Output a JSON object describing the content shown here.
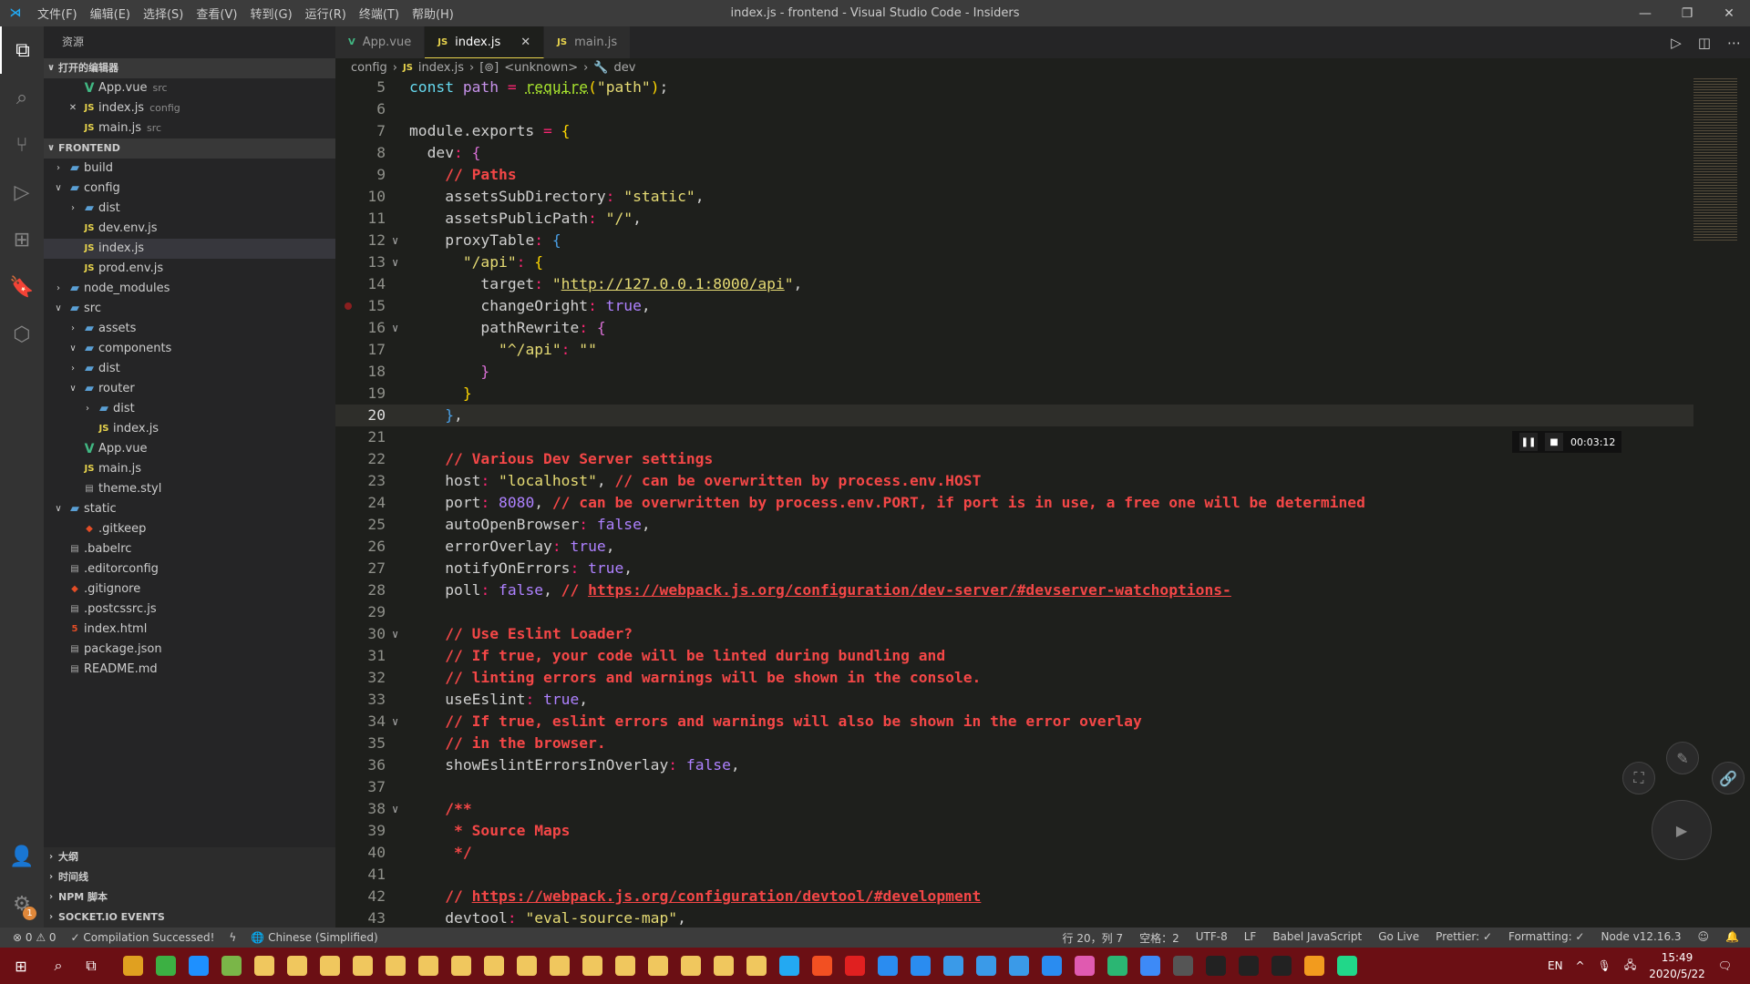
{
  "titlebar": {
    "menus": [
      "文件(F)",
      "编辑(E)",
      "选择(S)",
      "查看(V)",
      "转到(G)",
      "运行(R)",
      "终端(T)",
      "帮助(H)"
    ],
    "title": "index.js - frontend - Visual Studio Code - Insiders"
  },
  "activity": [
    "explorer-icon",
    "search-icon",
    "source-control-icon",
    "run-debug-icon",
    "extensions-icon",
    "bookmark-icon",
    "package-icon"
  ],
  "activity_bottom": {
    "account": "account-icon",
    "settings": "gear-icon",
    "badge": "1"
  },
  "sidebar": {
    "header": "资源",
    "rows": [
      {
        "type": "section",
        "label": "打开的编辑器",
        "open": true
      },
      {
        "depth": 1,
        "icon": "vue",
        "label": "App.vue",
        "desc": "src"
      },
      {
        "depth": 1,
        "icon": "js",
        "label": "index.js",
        "desc": "config",
        "close": true
      },
      {
        "depth": 1,
        "icon": "js",
        "label": "main.js",
        "desc": "src"
      },
      {
        "type": "section",
        "label": "FRONTEND",
        "open": true
      },
      {
        "depth": 0,
        "icon": "folder",
        "label": "build",
        "chev": "closed"
      },
      {
        "depth": 0,
        "icon": "folder",
        "label": "config",
        "chev": "open"
      },
      {
        "depth": 1,
        "icon": "folder",
        "label": "dist",
        "chev": "closed"
      },
      {
        "depth": 1,
        "icon": "js",
        "label": "dev.env.js"
      },
      {
        "depth": 1,
        "icon": "js",
        "label": "index.js",
        "selected": true
      },
      {
        "depth": 1,
        "icon": "js",
        "label": "prod.env.js"
      },
      {
        "depth": 0,
        "icon": "folder",
        "label": "node_modules",
        "chev": "closed"
      },
      {
        "depth": 0,
        "icon": "folder",
        "label": "src",
        "chev": "open"
      },
      {
        "depth": 1,
        "icon": "folder",
        "label": "assets",
        "chev": "closed"
      },
      {
        "depth": 1,
        "icon": "folder",
        "label": "components",
        "chev": "open"
      },
      {
        "depth": 1,
        "icon": "folder",
        "label": "dist",
        "chev": "closed"
      },
      {
        "depth": 1,
        "icon": "folder",
        "label": "router",
        "chev": "open"
      },
      {
        "depth": 2,
        "icon": "folder",
        "label": "dist",
        "chev": "closed"
      },
      {
        "depth": 2,
        "icon": "js",
        "label": "index.js"
      },
      {
        "depth": 1,
        "icon": "vue",
        "label": "App.vue"
      },
      {
        "depth": 1,
        "icon": "js",
        "label": "main.js"
      },
      {
        "depth": 1,
        "icon": "file",
        "label": "theme.styl"
      },
      {
        "depth": 0,
        "icon": "folder",
        "label": "static",
        "chev": "open"
      },
      {
        "depth": 1,
        "icon": "git",
        "label": ".gitkeep"
      },
      {
        "depth": 0,
        "icon": "file",
        "label": ".babelrc"
      },
      {
        "depth": 0,
        "icon": "file",
        "label": ".editorconfig"
      },
      {
        "depth": 0,
        "icon": "git",
        "label": ".gitignore"
      },
      {
        "depth": 0,
        "icon": "file",
        "label": ".postcssrc.js"
      },
      {
        "depth": 0,
        "icon": "html",
        "label": "index.html"
      },
      {
        "depth": 0,
        "icon": "file",
        "label": "package.json"
      },
      {
        "depth": 0,
        "icon": "file",
        "label": "README.md"
      }
    ],
    "bottom": [
      "大纲",
      "时间线",
      "NPM 脚本",
      "SOCKET.IO EVENTS"
    ]
  },
  "tabs": [
    {
      "label": "App.vue",
      "icon": "vue"
    },
    {
      "label": "index.js",
      "icon": "js",
      "active": true
    },
    {
      "label": "main.js",
      "icon": "js"
    }
  ],
  "breadcrumb": [
    "config",
    "index.js",
    "<unknown>",
    "dev"
  ],
  "editor": {
    "current_line": 20,
    "breakpoint_line": 15,
    "fold_lines": [
      12,
      13,
      16,
      30,
      34,
      38
    ],
    "lines": [
      [
        5,
        [
          [
            "kw",
            "const "
          ],
          [
            "v",
            "path"
          ],
          [
            "p",
            " = "
          ],
          [
            "f",
            "require"
          ],
          [
            "b1",
            "("
          ],
          [
            "s",
            "\"path\""
          ],
          [
            "b1",
            ")"
          ],
          [
            "w",
            ";"
          ]
        ]
      ],
      [
        6,
        []
      ],
      [
        7,
        [
          [
            "k",
            "module.exports"
          ],
          [
            "p",
            " = "
          ],
          [
            "b1",
            "{"
          ]
        ]
      ],
      [
        8,
        [
          [
            "w",
            "  "
          ],
          [
            "k",
            "dev"
          ],
          [
            "p",
            ": "
          ],
          [
            "b2",
            "{"
          ]
        ]
      ],
      [
        9,
        [
          [
            "w",
            "    "
          ],
          [
            "c",
            "// Paths"
          ]
        ]
      ],
      [
        10,
        [
          [
            "w",
            "    "
          ],
          [
            "k",
            "assetsSubDirectory"
          ],
          [
            "p",
            ": "
          ],
          [
            "s",
            "\"static\""
          ],
          [
            "w",
            ","
          ]
        ]
      ],
      [
        11,
        [
          [
            "w",
            "    "
          ],
          [
            "k",
            "assetsPublicPath"
          ],
          [
            "p",
            ": "
          ],
          [
            "s",
            "\"/\""
          ],
          [
            "w",
            ","
          ]
        ]
      ],
      [
        12,
        [
          [
            "w",
            "    "
          ],
          [
            "k",
            "proxyTable"
          ],
          [
            "p",
            ": "
          ],
          [
            "b3",
            "{"
          ]
        ]
      ],
      [
        13,
        [
          [
            "w",
            "      "
          ],
          [
            "s",
            "\"/api\""
          ],
          [
            "p",
            ": "
          ],
          [
            "b1",
            "{"
          ]
        ]
      ],
      [
        14,
        [
          [
            "w",
            "        "
          ],
          [
            "k",
            "target"
          ],
          [
            "p",
            ": "
          ],
          [
            "s",
            "\""
          ],
          [
            "su",
            "http://127.0.0.1:8000/api"
          ],
          [
            "s",
            "\""
          ],
          [
            "w",
            ","
          ]
        ]
      ],
      [
        15,
        [
          [
            "w",
            "        "
          ],
          [
            "k",
            "changeOright"
          ],
          [
            "p",
            ": "
          ],
          [
            "b",
            "true"
          ],
          [
            "w",
            ","
          ]
        ]
      ],
      [
        16,
        [
          [
            "w",
            "        "
          ],
          [
            "k",
            "pathRewrite"
          ],
          [
            "p",
            ": "
          ],
          [
            "b2",
            "{"
          ]
        ]
      ],
      [
        17,
        [
          [
            "w",
            "          "
          ],
          [
            "s",
            "\"^/api\""
          ],
          [
            "p",
            ": "
          ],
          [
            "s",
            "\"\""
          ]
        ]
      ],
      [
        18,
        [
          [
            "w",
            "        "
          ],
          [
            "b2",
            "}"
          ]
        ]
      ],
      [
        19,
        [
          [
            "w",
            "      "
          ],
          [
            "b1",
            "}"
          ]
        ]
      ],
      [
        20,
        [
          [
            "w",
            "    "
          ],
          [
            "b3",
            "}"
          ],
          [
            "w",
            ","
          ]
        ]
      ],
      [
        21,
        []
      ],
      [
        22,
        [
          [
            "w",
            "    "
          ],
          [
            "c",
            "// Various Dev Server settings"
          ]
        ]
      ],
      [
        23,
        [
          [
            "w",
            "    "
          ],
          [
            "k",
            "host"
          ],
          [
            "p",
            ": "
          ],
          [
            "s",
            "\"localhost\""
          ],
          [
            "w",
            ", "
          ],
          [
            "c",
            "// can be overwritten by process.env.HOST"
          ]
        ]
      ],
      [
        24,
        [
          [
            "w",
            "    "
          ],
          [
            "k",
            "port"
          ],
          [
            "p",
            ": "
          ],
          [
            "n",
            "8080"
          ],
          [
            "w",
            ", "
          ],
          [
            "c",
            "// can be overwritten by process.env.PORT, if port is in use, a free one will be determined"
          ]
        ]
      ],
      [
        25,
        [
          [
            "w",
            "    "
          ],
          [
            "k",
            "autoOpenBrowser"
          ],
          [
            "p",
            ": "
          ],
          [
            "b",
            "false"
          ],
          [
            "w",
            ","
          ]
        ]
      ],
      [
        26,
        [
          [
            "w",
            "    "
          ],
          [
            "k",
            "errorOverlay"
          ],
          [
            "p",
            ": "
          ],
          [
            "b",
            "true"
          ],
          [
            "w",
            ","
          ]
        ]
      ],
      [
        27,
        [
          [
            "w",
            "    "
          ],
          [
            "k",
            "notifyOnErrors"
          ],
          [
            "p",
            ": "
          ],
          [
            "b",
            "true"
          ],
          [
            "w",
            ","
          ]
        ]
      ],
      [
        28,
        [
          [
            "w",
            "    "
          ],
          [
            "k",
            "poll"
          ],
          [
            "p",
            ": "
          ],
          [
            "b",
            "false"
          ],
          [
            "w",
            ", "
          ],
          [
            "c",
            "// "
          ],
          [
            "cu",
            "https://webpack.js.org/configuration/dev-server/#devserver-watchoptions-"
          ]
        ]
      ],
      [
        29,
        []
      ],
      [
        30,
        [
          [
            "w",
            "    "
          ],
          [
            "c",
            "// Use Eslint Loader?"
          ]
        ]
      ],
      [
        31,
        [
          [
            "w",
            "    "
          ],
          [
            "c",
            "// If true, your code will be linted during bundling and"
          ]
        ]
      ],
      [
        32,
        [
          [
            "w",
            "    "
          ],
          [
            "c",
            "// linting errors and warnings will be shown in the console."
          ]
        ]
      ],
      [
        33,
        [
          [
            "w",
            "    "
          ],
          [
            "k",
            "useEslint"
          ],
          [
            "p",
            ": "
          ],
          [
            "b",
            "true"
          ],
          [
            "w",
            ","
          ]
        ]
      ],
      [
        34,
        [
          [
            "w",
            "    "
          ],
          [
            "c",
            "// If true, eslint errors and warnings will also be shown in the error overlay"
          ]
        ]
      ],
      [
        35,
        [
          [
            "w",
            "    "
          ],
          [
            "c",
            "// in the browser."
          ]
        ]
      ],
      [
        36,
        [
          [
            "w",
            "    "
          ],
          [
            "k",
            "showEslintErrorsInOverlay"
          ],
          [
            "p",
            ": "
          ],
          [
            "b",
            "false"
          ],
          [
            "w",
            ","
          ]
        ]
      ],
      [
        37,
        []
      ],
      [
        38,
        [
          [
            "w",
            "    "
          ],
          [
            "c",
            "/**"
          ]
        ]
      ],
      [
        39,
        [
          [
            "w",
            "    "
          ],
          [
            "c",
            " * Source Maps"
          ]
        ]
      ],
      [
        40,
        [
          [
            "w",
            "    "
          ],
          [
            "c",
            " */"
          ]
        ]
      ],
      [
        41,
        []
      ],
      [
        42,
        [
          [
            "w",
            "    "
          ],
          [
            "c",
            "// "
          ],
          [
            "cu",
            "https://webpack.js.org/configuration/devtool/#development"
          ]
        ]
      ],
      [
        43,
        [
          [
            "w",
            "    "
          ],
          [
            "k",
            "devtool"
          ],
          [
            "p",
            ": "
          ],
          [
            "s",
            "\"eval-source-map\""
          ],
          [
            "w",
            ","
          ]
        ]
      ]
    ]
  },
  "recorder": {
    "time": "00:03:12"
  },
  "statusbar": {
    "errors": "0",
    "warnings": "0",
    "compilation": "✓ Compilation Successed!",
    "language_pack": "Chinese (Simplified)",
    "right": [
      "行 20，列 7",
      "空格：2",
      "UTF-8",
      "LF",
      "Babel JavaScript",
      "Go Live",
      "Prettier: ✓",
      "Formatting: ✓",
      "Node v12.16.3"
    ]
  },
  "taskbar": {
    "apps": [
      [
        "chrome",
        "#e0a020"
      ],
      [
        "360-browser",
        "#3cb043"
      ],
      [
        "qq-browser",
        "#1e90ff"
      ],
      [
        "notepad",
        "#7ab648"
      ],
      [
        "folder",
        "#f0c75e"
      ],
      [
        "folder",
        "#f0c75e"
      ],
      [
        "folder",
        "#f0c75e"
      ],
      [
        "folder",
        "#f0c75e"
      ],
      [
        "folder",
        "#f0c75e"
      ],
      [
        "folder",
        "#f0c75e"
      ],
      [
        "folder",
        "#f0c75e"
      ],
      [
        "folder",
        "#f0c75e"
      ],
      [
        "folder",
        "#f0c75e"
      ],
      [
        "folder",
        "#f0c75e"
      ],
      [
        "folder",
        "#f0c75e"
      ],
      [
        "folder",
        "#f0c75e"
      ],
      [
        "folder",
        "#f0c75e"
      ],
      [
        "folder",
        "#f0c75e"
      ],
      [
        "folder",
        "#f0c75e"
      ],
      [
        "folder",
        "#f0c75e"
      ],
      [
        "vscode",
        "#23a9f2"
      ],
      [
        "store",
        "#f25022"
      ],
      [
        "youdao",
        "#e02020"
      ],
      [
        "app",
        "#2a8cf0"
      ],
      [
        "app",
        "#2a8cf0"
      ],
      [
        "ie",
        "#3a9ae8"
      ],
      [
        "ie",
        "#3a9ae8"
      ],
      [
        "ie",
        "#3a9ae8"
      ],
      [
        "media",
        "#2a8cf0"
      ],
      [
        "picker",
        "#e05ab0"
      ],
      [
        "vscode-insiders",
        "#2bb673"
      ],
      [
        "wps",
        "#3d8af7"
      ],
      [
        "obs",
        "#555"
      ],
      [
        "terminal",
        "#222"
      ],
      [
        "terminal",
        "#222"
      ],
      [
        "terminal",
        "#222"
      ],
      [
        "search",
        "#f29b1e"
      ],
      [
        "pycharm",
        "#21d789"
      ]
    ],
    "ime": "EN",
    "time": "15:49",
    "date": "2020/5/22"
  }
}
